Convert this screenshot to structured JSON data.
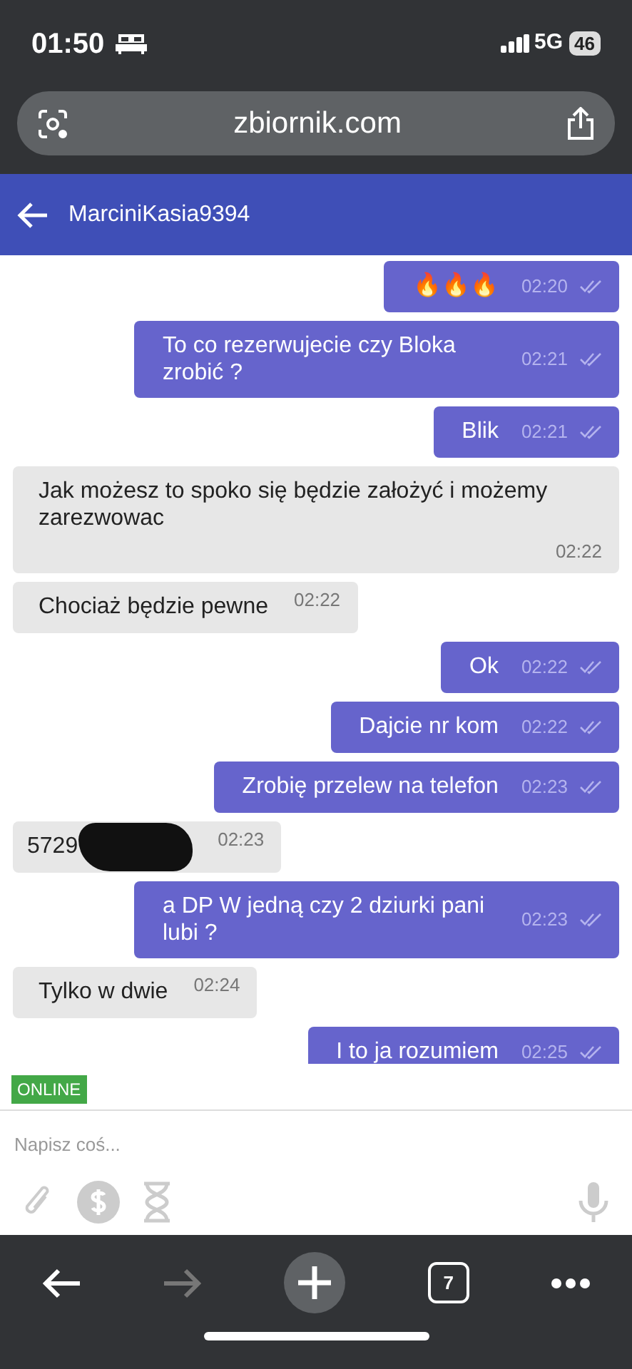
{
  "status_bar": {
    "time": "01:50",
    "network": "5G",
    "battery": "46"
  },
  "browser": {
    "url": "zbiornik.com",
    "tabs_count": "7"
  },
  "header": {
    "title": "MarciniKasia9394"
  },
  "messages": [
    {
      "kind": "sent",
      "text": "🔥🔥🔥",
      "time": "02:20",
      "read": true
    },
    {
      "kind": "sent",
      "text": "To co rezerwujecie czy Bloka zrobić ?",
      "time": "02:21",
      "read": true
    },
    {
      "kind": "sent",
      "text": "Blik",
      "time": "02:21",
      "read": true
    },
    {
      "kind": "received",
      "text": "Jak możesz to spoko się będzie założyć i możemy zarezwowac",
      "time": "02:22"
    },
    {
      "kind": "received",
      "text": "Chociaż będzie pewne",
      "time": "02:22"
    },
    {
      "kind": "sent",
      "text": "Ok",
      "time": "02:22",
      "read": true
    },
    {
      "kind": "sent",
      "text": "Dajcie nr kom",
      "time": "02:22",
      "read": true
    },
    {
      "kind": "sent",
      "text": "Zrobię przelew na telefon",
      "time": "02:23",
      "read": true
    },
    {
      "kind": "received",
      "text": "5729",
      "time": "02:23",
      "redacted": true
    },
    {
      "kind": "sent",
      "text": "a DP W jedną czy 2 dziurki pani lubi ?",
      "time": "02:23",
      "read": true
    },
    {
      "kind": "received",
      "text": "Tylko w dwie",
      "time": "02:24"
    },
    {
      "kind": "sent",
      "text": "I to ja rozumiem",
      "time": "02:25",
      "read": true
    }
  ],
  "presence": {
    "label": "ONLINE"
  },
  "composer": {
    "placeholder": "Napisz coś..."
  }
}
